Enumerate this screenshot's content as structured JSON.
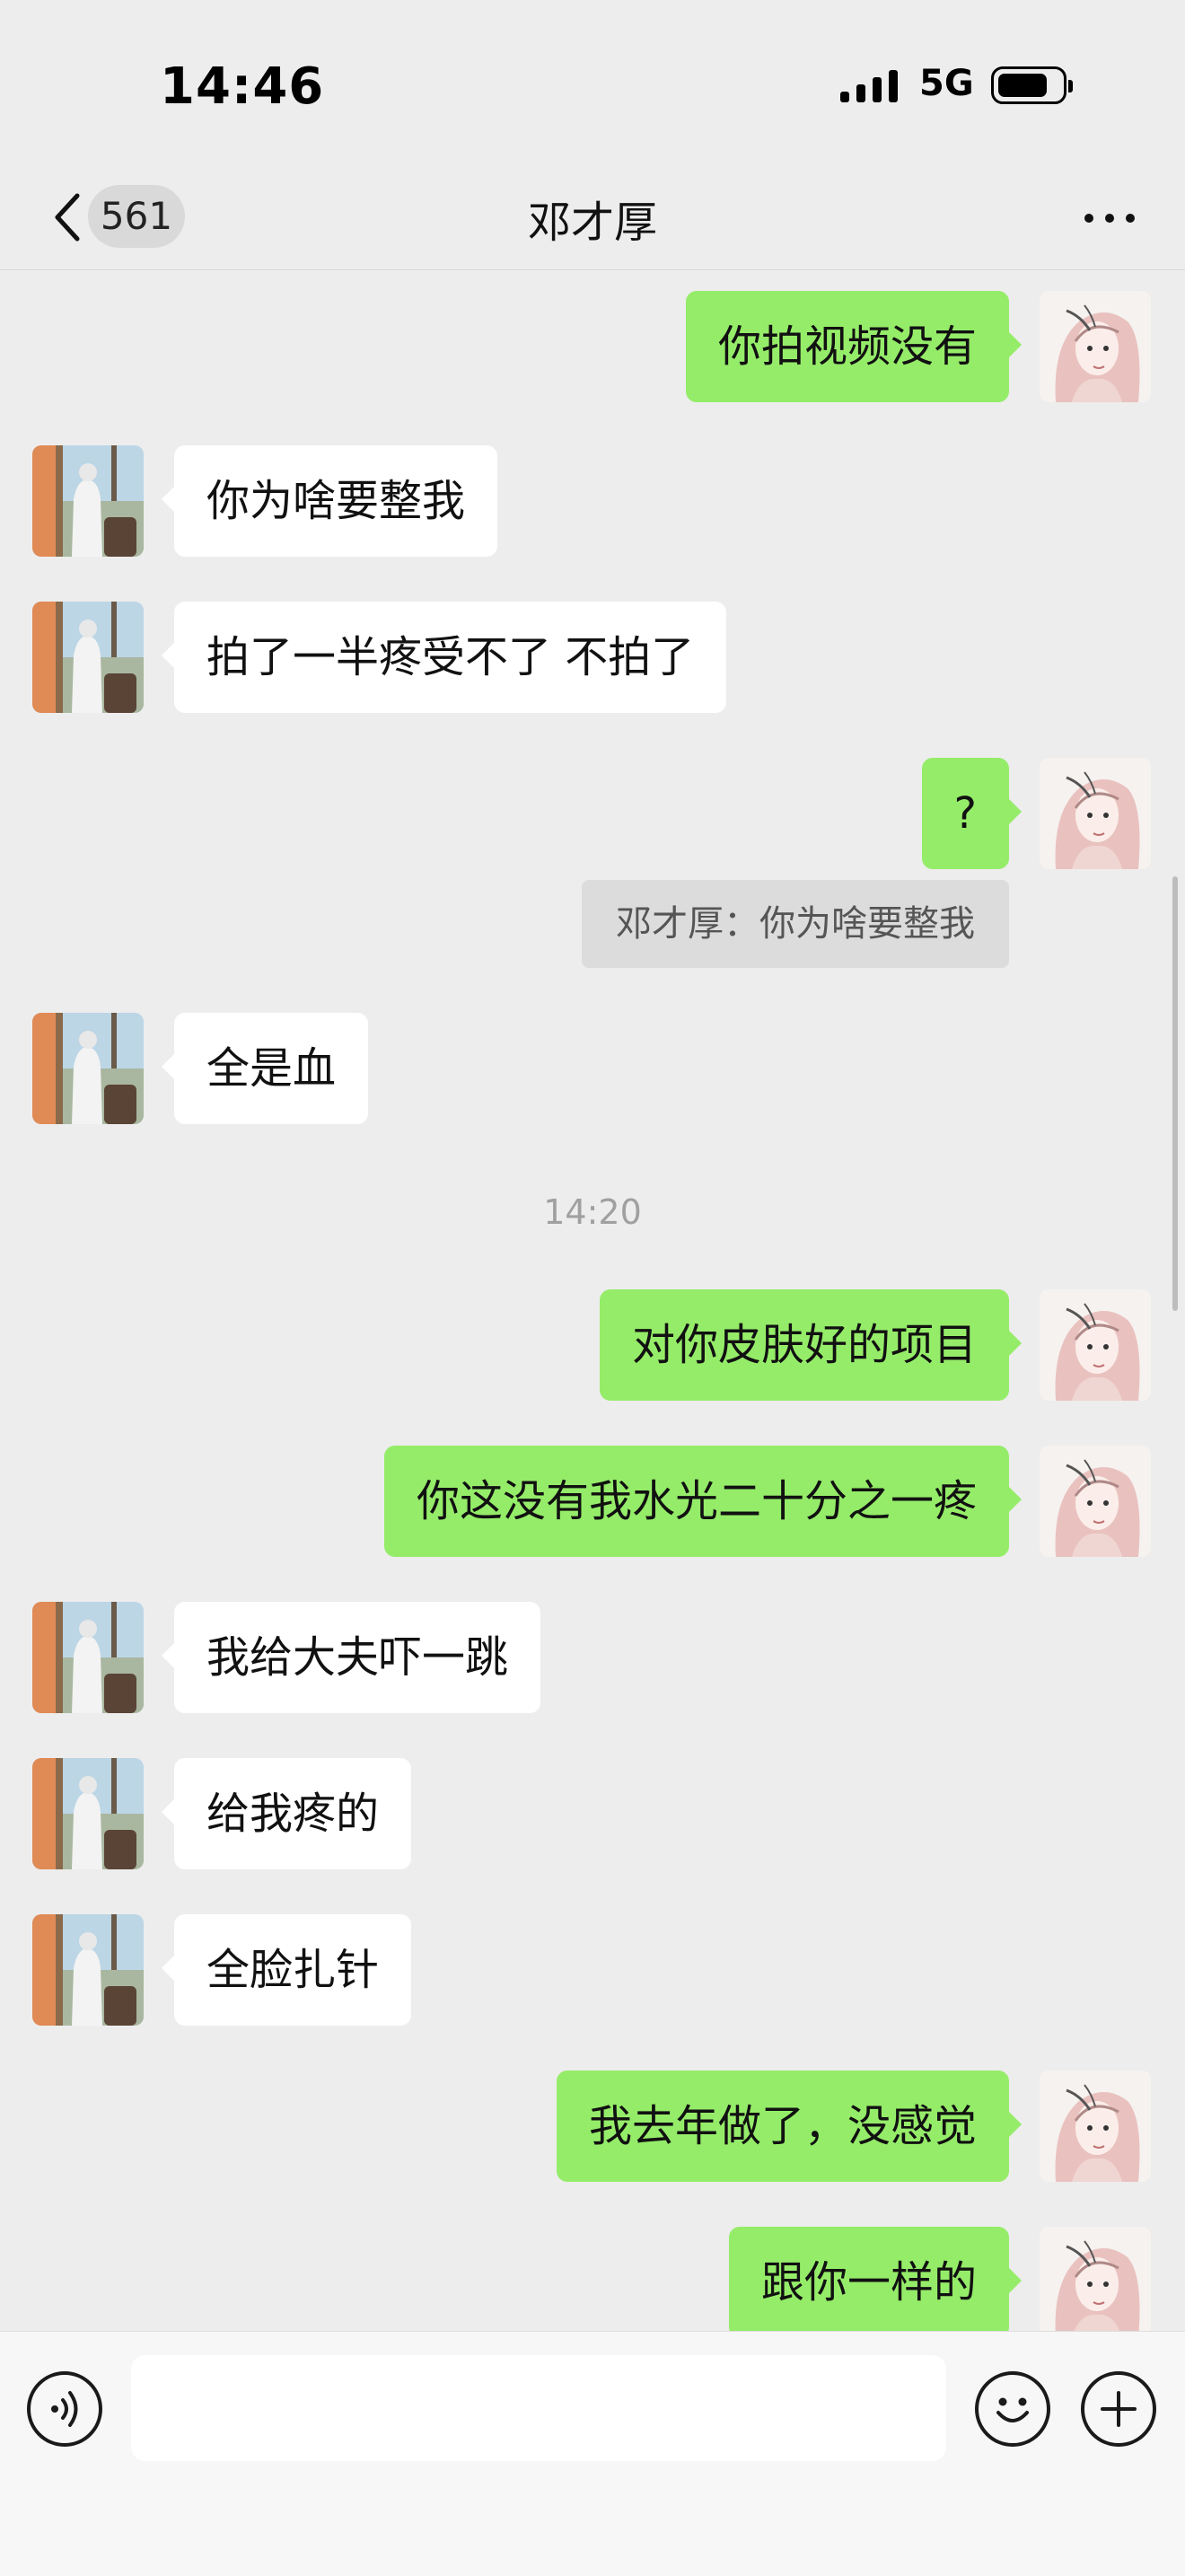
{
  "status_bar": {
    "time": "14:46",
    "network": "5G",
    "battery_level": 0.8,
    "signal_icon": "signal-bars-icon"
  },
  "header": {
    "back_icon": "chevron-left-icon",
    "unread_count": "561",
    "title": "邓才厚",
    "more_icon": "more-dots-icon"
  },
  "messages": [
    {
      "side": "out",
      "text": "你拍视频没有"
    },
    {
      "side": "in",
      "text": "你为啥要整我"
    },
    {
      "side": "in",
      "text": "拍了一半疼受不了 不拍了"
    },
    {
      "side": "out",
      "text": "?"
    },
    {
      "side": "in",
      "text": "全是血"
    },
    {
      "side": "out",
      "text": "对你皮肤好的项目"
    },
    {
      "side": "out",
      "text": "你这没有我水光二十分之一疼"
    },
    {
      "side": "in",
      "text": "我给大夫吓一跳"
    },
    {
      "side": "in",
      "text": "给我疼的"
    },
    {
      "side": "in",
      "text": "全脸扎针"
    },
    {
      "side": "out",
      "text": "我去年做了，没感觉"
    },
    {
      "side": "out",
      "text": "跟你一样的"
    }
  ],
  "quote": {
    "text": "邓才厚：你为啥要整我"
  },
  "time_divider": "14:20",
  "input_bar": {
    "placeholder": "",
    "value": "",
    "voice_icon": "voice-icon",
    "emoji_icon": "emoji-icon",
    "plus_icon": "plus-icon"
  },
  "colors": {
    "background": "#ededed",
    "outgoing_bubble": "#95ec69",
    "incoming_bubble": "#ffffff",
    "quote_background": "#dcdcdc"
  }
}
